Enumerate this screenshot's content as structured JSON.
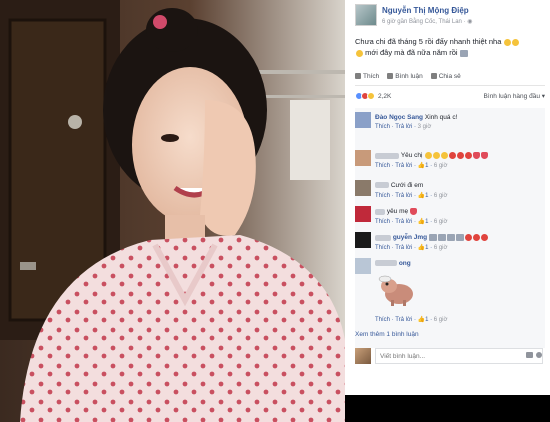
{
  "post": {
    "author": "Nguyễn Thị Mộng Điệp",
    "meta": "6 giờ gần Bằng Cốc, Thái Lan · ",
    "text_line1": "Chưa chi đã tháng 5 rồi đấy nhanh thiệt nha",
    "text_line2": "mới đây mà đã nữa năm rồi"
  },
  "actions": {
    "like": "Thích",
    "comment": "Bình luận",
    "share": "Chia sẻ"
  },
  "reactions": {
    "count": "2,2K",
    "sort": "Bình luận hàng đầu ▾",
    "colors": [
      "#5890ff",
      "#e0443e",
      "#f5c33b"
    ]
  },
  "comments": [
    {
      "name": "Đào Ngọc Sang",
      "text": "Xinh quá c!",
      "reply": "Trả lời",
      "likes": "",
      "time": "3 giờ",
      "avatar": "#8aa0c8"
    },
    {
      "name": "",
      "text": "Yêu chị",
      "reply": "Trả lời",
      "likes": "1",
      "time": "6 giờ",
      "avatar": "#c89a7a"
    },
    {
      "name": "",
      "text": "Cưới đi em",
      "reply": "Trả lời",
      "likes": "1",
      "time": "6 giờ",
      "avatar": "#8a7a6a"
    },
    {
      "name": "",
      "text": "yêu mẹ",
      "reply": "Trả lời",
      "likes": "1",
      "time": "6 giờ",
      "avatar": "#c0293a"
    },
    {
      "name": "guyễn Jmg",
      "text": "",
      "reply": "Trả lời",
      "likes": "1",
      "time": "6 giờ",
      "avatar": "#1a1a1a"
    },
    {
      "name": "ong",
      "text": "",
      "reply": "Thích · Trả lời",
      "likes": "1",
      "time": "6 giờ",
      "avatar": "#b9c6d6"
    }
  ],
  "more": {
    "label": "Xem thêm 1 bình luận"
  },
  "composer": {
    "placeholder": "Viết bình luận..."
  }
}
